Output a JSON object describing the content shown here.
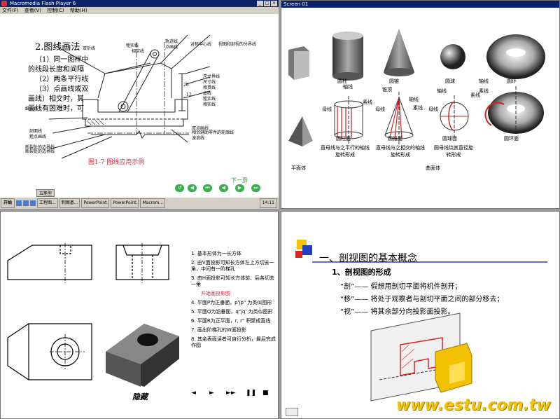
{
  "player": {
    "title": "Macromedia Flash Player 6",
    "menu": [
      "文件(F)",
      "查看(V)",
      "控制(C)",
      "帮助(H)"
    ],
    "content": {
      "heading": "2.图线画法",
      "lines": [
        "（1）同一图样中",
        "的线段长度和间隔",
        "（2）两条平行线",
        "（3）点画线或双",
        "画线）相交时，其",
        "画线有困难时，可"
      ],
      "caption": "图1-7    图线应用示例",
      "labels": [
        "双折线",
        "粗实线",
        "相实线",
        "细实线",
        "断裂处的边界线",
        "剖面线",
        "粗点画线",
        "轨迹线",
        "点画线",
        "对称中心线",
        "视图和剖视的分界线",
        "尺寸界线",
        "尺寸线",
        "相贯线",
        "虚线",
        "粗实线",
        "相实线",
        "双点画线",
        "相邻辅助零件的轮廓线",
        "波浪线",
        "断裂处的边界线",
        "28",
        "12"
      ],
      "nav_next": "下一页",
      "tab_label": "五笔型"
    },
    "taskbar": {
      "start": "开始",
      "tasks": [
        "工程图...",
        "制图基...",
        "PowerPoint...",
        "PowerPoint...",
        "Macrom..."
      ],
      "clock": "14:11"
    }
  },
  "screen2": {
    "title": "Screen 01",
    "shapes": [
      "圆柱",
      "圆锥",
      "圆球",
      "圆环"
    ],
    "labels": {
      "axis": "轴线",
      "generatrix": "素线",
      "generatrix2": "母线",
      "apex": "锥顶"
    },
    "bottom_labels": [
      "圆柱面",
      "圆锥面",
      "圆球面",
      "圆环面"
    ],
    "descriptions": [
      "直母线与之平行的轴线旋转形成",
      "直母线与之相交的轴线旋转形成",
      "圆母线绕其直径旋转形成"
    ],
    "planar": "平面体",
    "curved": "曲面体"
  },
  "screen3": {
    "steps": [
      "1. 基本形体为一长方体",
      "2. 由V面投影可知长方体左上方切去一角，中间有一阶梯孔",
      "3. 由H面投影可知长方体前、后各切去一角",
      "开始画投影图",
      "4. 平面P为正垂面，p'jp\" 为类似图形",
      "5. 平面Q为铅垂面，q\"jq' 为类似图形",
      "6. 平面R为正平面，r, r\" 积聚成直线",
      "7. 画出阶梯孔的W面投影",
      "8. 其余表面读者可自行分析，最后完成作图"
    ],
    "hide_label": "隐藏",
    "controls": [
      "◄",
      "►",
      "►►",
      "❚❚",
      "■"
    ]
  },
  "screen4": {
    "section_title": "一、剖视图的基本概念",
    "subsection": "1、剖视图的形成",
    "items": [
      "“剖”——  假想用剖切平面将机件剖开；",
      "“移”——  将处于观察者与剖切平面之间的部分移去；",
      "“视”——  将其余部分向投影面投影。"
    ],
    "watermark": "www.estu.com.tw"
  },
  "colors": {
    "titlebar": "#0a246a",
    "caption_red": "#d23",
    "nav_green": "#35b04a",
    "watermark": "#f5c400"
  }
}
